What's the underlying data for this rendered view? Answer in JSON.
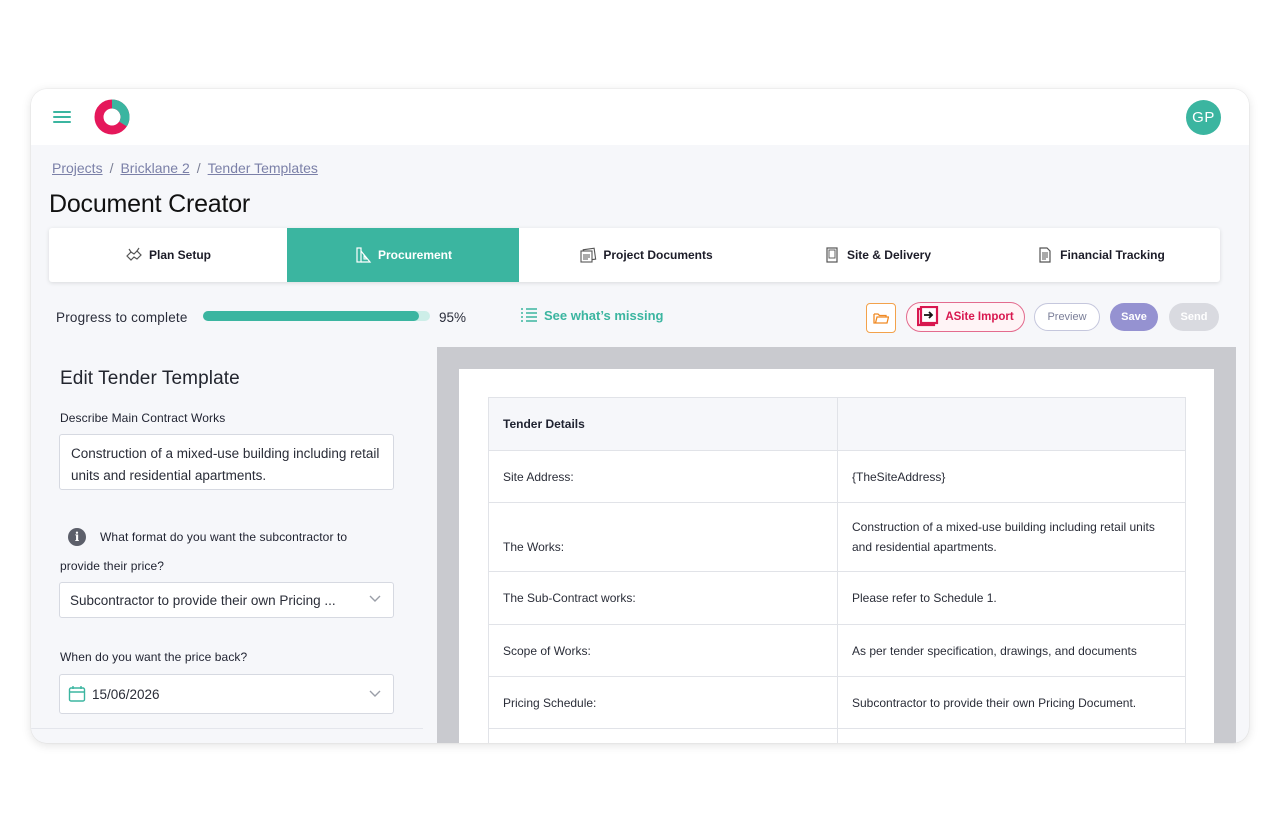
{
  "header": {
    "avatar_initials": "GP",
    "brand_colors": {
      "teal": "#3bb5a0",
      "pink": "#e5185b"
    }
  },
  "breadcrumb": {
    "items": [
      "Projects",
      "Bricklane 2",
      "Tender Templates"
    ],
    "separator": "/"
  },
  "page": {
    "title": "Document Creator"
  },
  "tabs": [
    {
      "label": "Plan Setup",
      "icon": "handshake-icon",
      "active": false
    },
    {
      "label": "Procurement",
      "icon": "blueprint-icon",
      "active": true
    },
    {
      "label": "Project Documents",
      "icon": "documents-icon",
      "active": false
    },
    {
      "label": "Site & Delivery",
      "icon": "building-icon",
      "active": false
    },
    {
      "label": "Financial Tracking",
      "icon": "ledger-icon",
      "active": false
    }
  ],
  "progress": {
    "label": "Progress to complete",
    "value": 95,
    "value_text": "95%",
    "missing_link": "See what’s missing"
  },
  "toolbar": {
    "asite_label": "ASite Import",
    "preview_label": "Preview",
    "save_label": "Save",
    "send_label": "Send"
  },
  "editor": {
    "title": "Edit Tender Template",
    "main_works_label": "Describe Main Contract Works",
    "main_works_value": "Construction of a mixed-use building including retail units and residential apartments.",
    "format_question_line1": "What format do you want the subcontractor to",
    "format_question_line2": "provide their price?",
    "format_selected": "Subcontractor to provide their own Pricing ...",
    "price_back_label": "When do you want the price back?",
    "price_back_date": "15/06/2026"
  },
  "document": {
    "header": "Tender Details",
    "rows": [
      {
        "key": "Site Address:",
        "value": "{TheSiteAddress}"
      },
      {
        "key": "The Works:",
        "value": "Construction of a mixed-use building including retail units and residential apartments."
      },
      {
        "key": "The Sub-Contract works:",
        "value": "Please refer to Schedule 1."
      },
      {
        "key": "Scope of Works:",
        "value": "As per tender specification, drawings, and documents"
      },
      {
        "key": "Pricing Schedule:",
        "value": "Subcontractor to provide their own Pricing Document."
      },
      {
        "key": "",
        "value": ""
      }
    ]
  }
}
